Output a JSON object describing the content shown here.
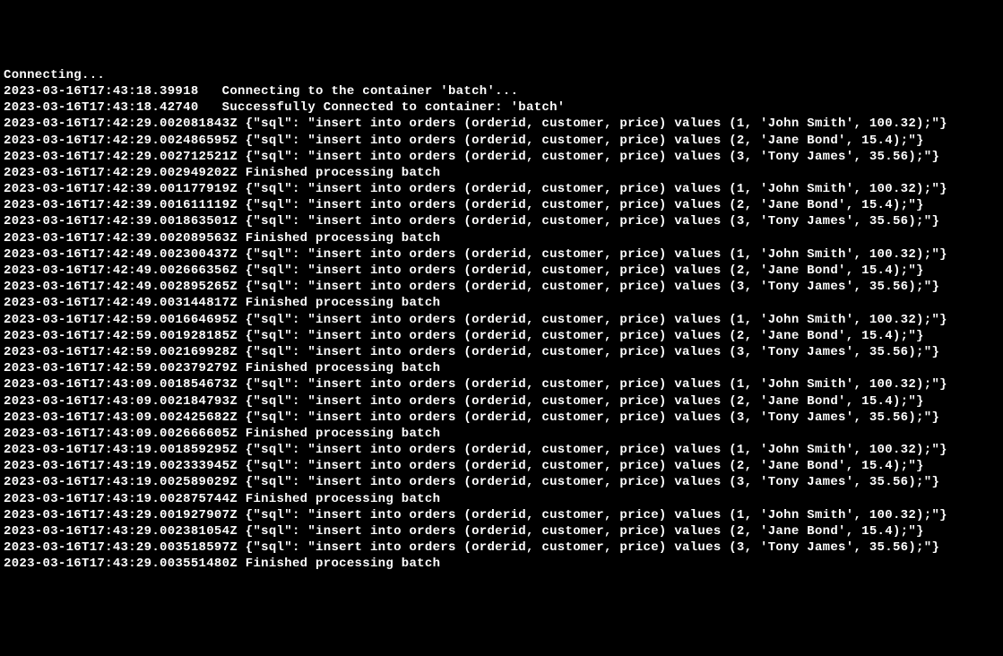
{
  "header": {
    "connecting": "Connecting...",
    "connect_msg1": "2023-03-16T17:43:18.39918   Connecting to the container 'batch'...",
    "connect_msg2": "2023-03-16T17:43:18.42740   Successfully Connected to container: 'batch'"
  },
  "batches": [
    {
      "rows": [
        {
          "ts": "2023-03-16T17:42:29.002081843Z",
          "sql": "insert into orders (orderid, customer, price) values (1, 'John Smith', 100.32);"
        },
        {
          "ts": "2023-03-16T17:42:29.002486595Z",
          "sql": "insert into orders (orderid, customer, price) values (2, 'Jane Bond', 15.4);"
        },
        {
          "ts": "2023-03-16T17:42:29.002712521Z",
          "sql": "insert into orders (orderid, customer, price) values (3, 'Tony James', 35.56);"
        }
      ],
      "finished": {
        "ts": "2023-03-16T17:42:29.002949202Z",
        "msg": "Finished processing batch"
      }
    },
    {
      "rows": [
        {
          "ts": "2023-03-16T17:42:39.001177919Z",
          "sql": "insert into orders (orderid, customer, price) values (1, 'John Smith', 100.32);"
        },
        {
          "ts": "2023-03-16T17:42:39.001611119Z",
          "sql": "insert into orders (orderid, customer, price) values (2, 'Jane Bond', 15.4);"
        },
        {
          "ts": "2023-03-16T17:42:39.001863501Z",
          "sql": "insert into orders (orderid, customer, price) values (3, 'Tony James', 35.56);"
        }
      ],
      "finished": {
        "ts": "2023-03-16T17:42:39.002089563Z",
        "msg": "Finished processing batch"
      }
    },
    {
      "rows": [
        {
          "ts": "2023-03-16T17:42:49.002300437Z",
          "sql": "insert into orders (orderid, customer, price) values (1, 'John Smith', 100.32);"
        },
        {
          "ts": "2023-03-16T17:42:49.002666356Z",
          "sql": "insert into orders (orderid, customer, price) values (2, 'Jane Bond', 15.4);"
        },
        {
          "ts": "2023-03-16T17:42:49.002895265Z",
          "sql": "insert into orders (orderid, customer, price) values (3, 'Tony James', 35.56);"
        }
      ],
      "finished": {
        "ts": "2023-03-16T17:42:49.003144817Z",
        "msg": "Finished processing batch"
      }
    },
    {
      "rows": [
        {
          "ts": "2023-03-16T17:42:59.001664695Z",
          "sql": "insert into orders (orderid, customer, price) values (1, 'John Smith', 100.32);"
        },
        {
          "ts": "2023-03-16T17:42:59.001928185Z",
          "sql": "insert into orders (orderid, customer, price) values (2, 'Jane Bond', 15.4);"
        },
        {
          "ts": "2023-03-16T17:42:59.002169928Z",
          "sql": "insert into orders (orderid, customer, price) values (3, 'Tony James', 35.56);"
        }
      ],
      "finished": {
        "ts": "2023-03-16T17:42:59.002379279Z",
        "msg": "Finished processing batch"
      }
    },
    {
      "rows": [
        {
          "ts": "2023-03-16T17:43:09.001854673Z",
          "sql": "insert into orders (orderid, customer, price) values (1, 'John Smith', 100.32);"
        },
        {
          "ts": "2023-03-16T17:43:09.002184793Z",
          "sql": "insert into orders (orderid, customer, price) values (2, 'Jane Bond', 15.4);"
        },
        {
          "ts": "2023-03-16T17:43:09.002425682Z",
          "sql": "insert into orders (orderid, customer, price) values (3, 'Tony James', 35.56);"
        }
      ],
      "finished": {
        "ts": "2023-03-16T17:43:09.002666605Z",
        "msg": "Finished processing batch"
      }
    },
    {
      "rows": [
        {
          "ts": "2023-03-16T17:43:19.001859295Z",
          "sql": "insert into orders (orderid, customer, price) values (1, 'John Smith', 100.32);"
        },
        {
          "ts": "2023-03-16T17:43:19.002333945Z",
          "sql": "insert into orders (orderid, customer, price) values (2, 'Jane Bond', 15.4);"
        },
        {
          "ts": "2023-03-16T17:43:19.002589029Z",
          "sql": "insert into orders (orderid, customer, price) values (3, 'Tony James', 35.56);"
        }
      ],
      "finished": {
        "ts": "2023-03-16T17:43:19.002875744Z",
        "msg": "Finished processing batch"
      }
    },
    {
      "rows": [
        {
          "ts": "2023-03-16T17:43:29.001927907Z",
          "sql": "insert into orders (orderid, customer, price) values (1, 'John Smith', 100.32);"
        },
        {
          "ts": "2023-03-16T17:43:29.002381054Z",
          "sql": "insert into orders (orderid, customer, price) values (2, 'Jane Bond', 15.4);"
        },
        {
          "ts": "2023-03-16T17:43:29.003518597Z",
          "sql": "insert into orders (orderid, customer, price) values (3, 'Tony James', 35.56);"
        }
      ],
      "finished": {
        "ts": "2023-03-16T17:43:29.003551480Z",
        "msg": "Finished processing batch"
      }
    }
  ]
}
